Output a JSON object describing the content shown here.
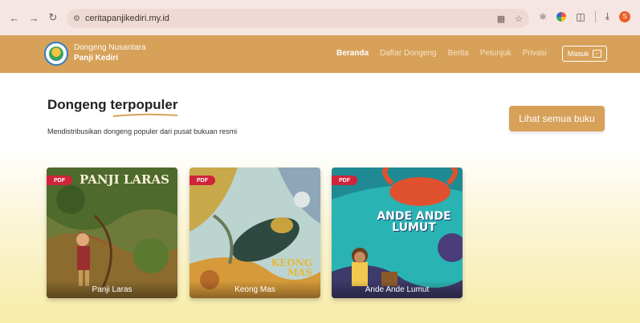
{
  "browser": {
    "url": "ceritapanjikediri.my.id",
    "profile_initial": "S"
  },
  "site": {
    "brand_line1": "Dongeng Nusantara",
    "brand_line2": "Panji Kediri",
    "nav": [
      {
        "label": "Beranda",
        "active": true
      },
      {
        "label": "Daftar Dongeng",
        "active": false
      },
      {
        "label": "Berita",
        "active": false
      },
      {
        "label": "Petunjuk",
        "active": false
      },
      {
        "label": "Privasi",
        "active": false
      }
    ],
    "login_label": "Masuk",
    "accent_color": "#d7a15a"
  },
  "main": {
    "title_part1": "Dongeng ",
    "title_part2": "terpopuler",
    "subtitle": "Mendistribusikan dongeng populer dari pusat bukuan resmi",
    "see_all_label": "Lihat semua buku"
  },
  "books": [
    {
      "title": "Panji Laras",
      "cover_text": "PANJI LARAS",
      "badge": "PDF"
    },
    {
      "title": "Keong Mas",
      "cover_text": "KEONG MAS",
      "badge": "PDF"
    },
    {
      "title": "Ande Ande Lumut",
      "cover_text": "ANDE ANDE LUMUT",
      "badge": "PDF"
    }
  ]
}
